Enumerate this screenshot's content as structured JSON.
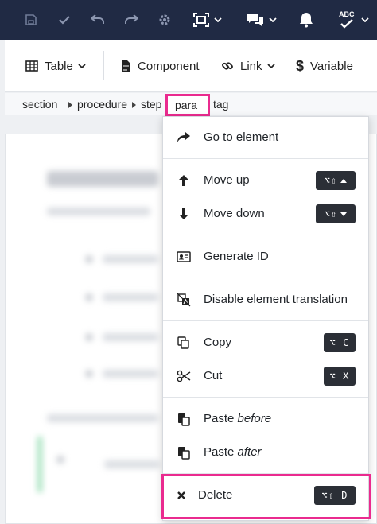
{
  "topbar": {
    "items": [
      {
        "icon": "save-icon"
      },
      {
        "icon": "check-icon"
      },
      {
        "icon": "undo-icon"
      },
      {
        "icon": "redo-icon"
      },
      {
        "icon": "gear-icon"
      },
      {
        "icon": "fullscreen-icon"
      },
      {
        "icon": "comments-icon"
      },
      {
        "icon": "bell-icon"
      },
      {
        "icon": "spellcheck-icon",
        "label": "ABC"
      }
    ]
  },
  "toolbar": {
    "table_label": "Table",
    "component_label": "Component",
    "link_label": "Link",
    "variable_label": "Variable"
  },
  "breadcrumb": {
    "items": [
      "section",
      "procedure",
      "step",
      "para",
      "tag"
    ],
    "active": "para"
  },
  "context_menu": {
    "go_to_element": "Go to element",
    "move_up": "Move up",
    "move_up_shortcut": "⌥⇧",
    "move_down": "Move down",
    "move_down_shortcut": "⌥⇧",
    "generate_id": "Generate ID",
    "disable_translation": "Disable element translation",
    "copy": "Copy",
    "copy_shortcut": "⌥ C",
    "cut": "Cut",
    "cut_shortcut": "⌥ X",
    "paste": "Paste",
    "before": "before",
    "after": "after",
    "delete": "Delete",
    "delete_shortcut": "⌥⇧ D"
  },
  "colors": {
    "topbar_bg": "#202a44",
    "highlight": "#ea2b8f",
    "kbd_bg": "#2b2f36"
  }
}
